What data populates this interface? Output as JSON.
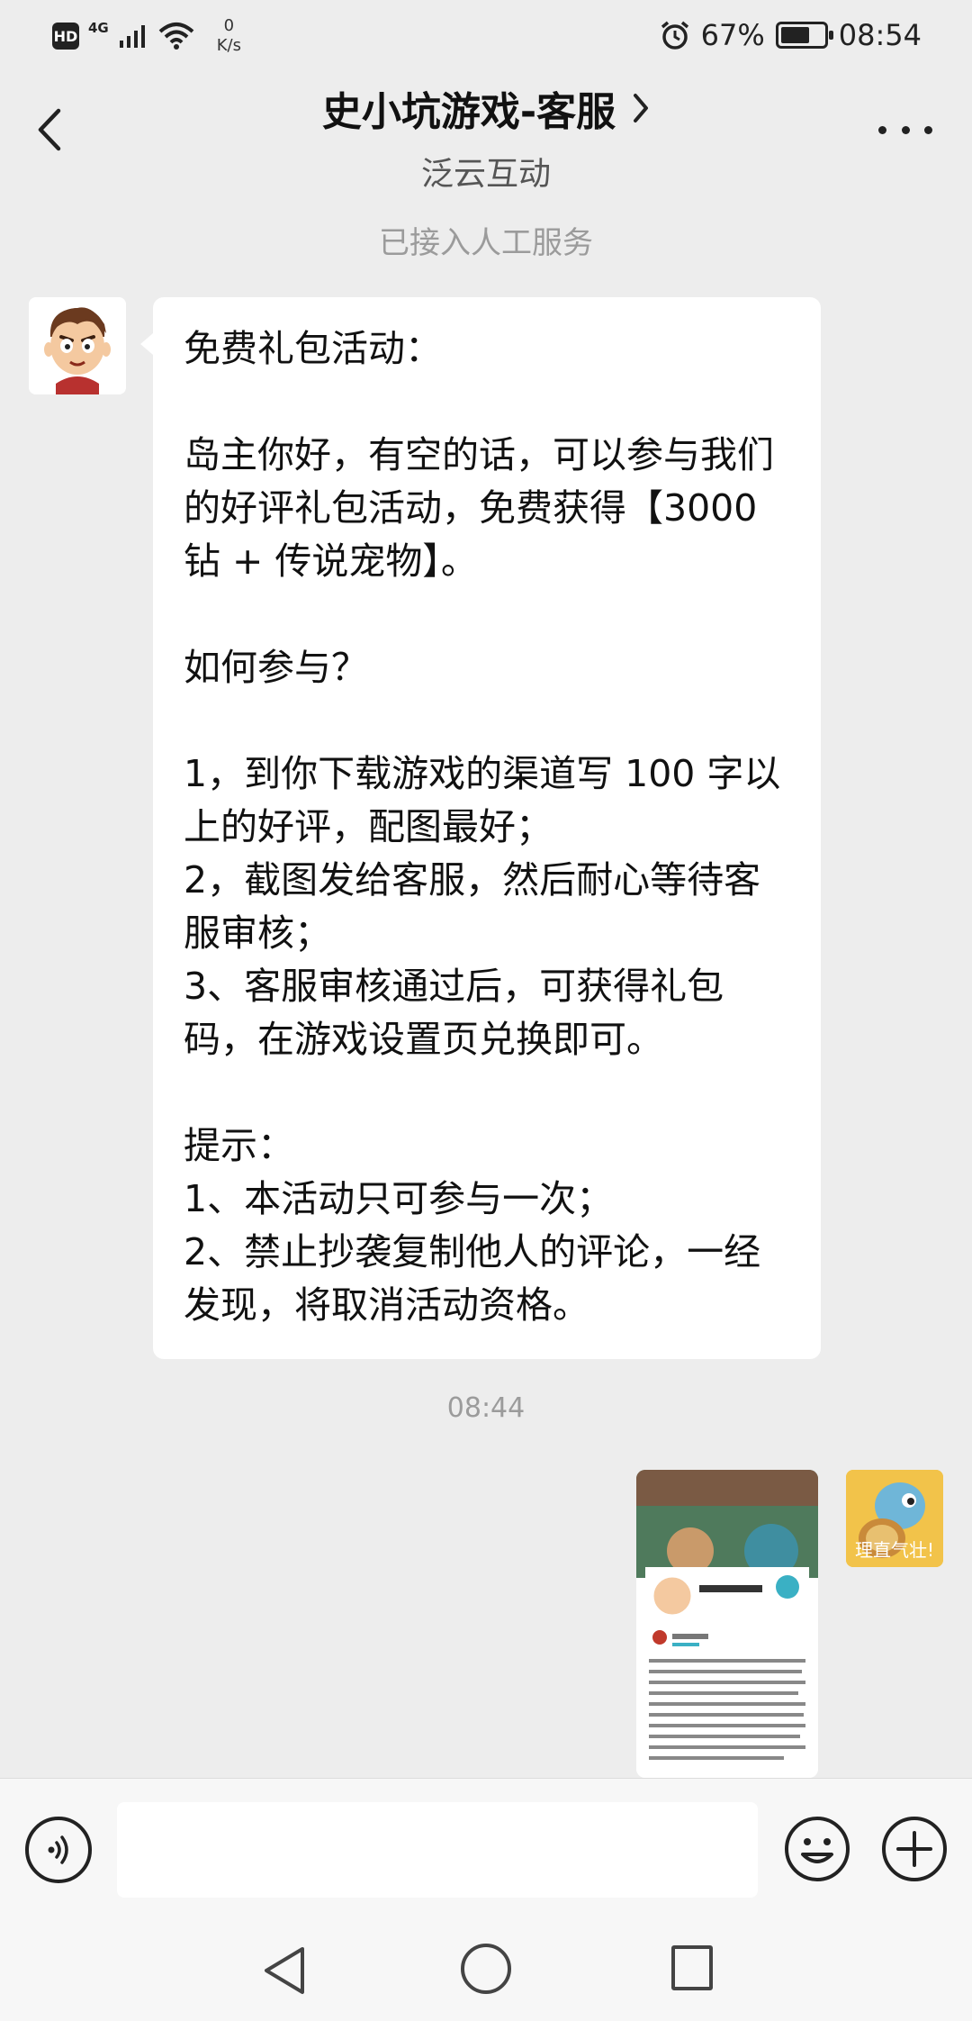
{
  "status_bar": {
    "hd_badge": "HD",
    "network": "4G",
    "speed_value": "0",
    "speed_unit": "K/s",
    "battery_percent": "67%",
    "battery_level": 0.67,
    "time": "08:54",
    "icons": [
      "signal-icon",
      "wifi-icon",
      "alarm-icon",
      "battery-icon"
    ]
  },
  "header": {
    "title": "史小坑游戏-客服",
    "subtitle": "泛云互动",
    "back_icon": "chevron-left-icon",
    "more_icon": "more-dots-icon"
  },
  "chat": {
    "system_note": "已接入人工服务",
    "message_text": "免费礼包活动：\n\n岛主你好，有空的话，可以参与我们的好评礼包活动，免费获得【3000 钻 + 传说宠物】。\n\n如何参与？\n\n1，到你下载游戏的渠道写 100 字以上的好评，配图最好；\n2，截图发给客服，然后耐心等待客服审核；\n3、客服审核通过后，可获得礼包码，在游戏设置页兑换即可。\n\n提示：\n1、本活动只可参与一次；\n2、禁止抄袭复制他人的评论，一经发现，将取消活动资格。",
    "timestamp": "08:44",
    "user_avatar_caption": "理直气壮!"
  },
  "input_bar": {
    "voice_icon": "voice-icon",
    "emoji_icon": "emoji-icon",
    "plus_icon": "plus-icon",
    "input_value": ""
  },
  "nav_bar": {
    "icons": [
      "nav-back-icon",
      "nav-home-icon",
      "nav-recent-icon"
    ]
  }
}
